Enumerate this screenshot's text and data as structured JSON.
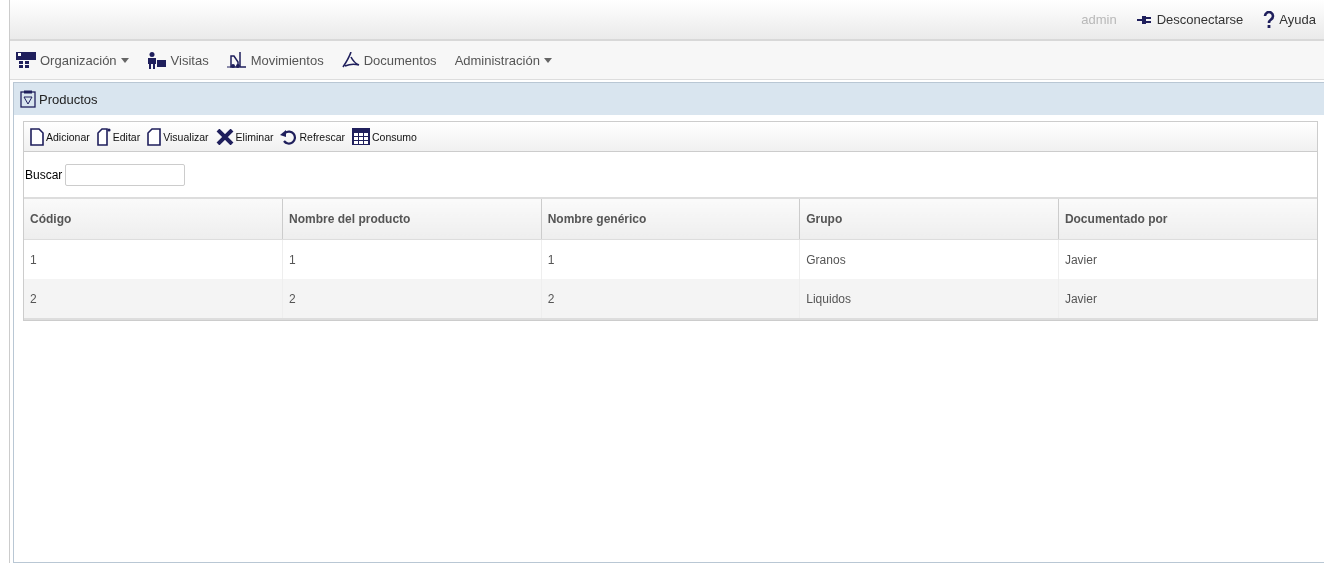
{
  "top_bar": {
    "user": "admin",
    "logout": "Desconectarse",
    "help": "Ayuda"
  },
  "menu": [
    {
      "label": "Organización",
      "dropdown": true
    },
    {
      "label": "Visitas",
      "dropdown": false
    },
    {
      "label": "Movimientos",
      "dropdown": false
    },
    {
      "label": "Documentos",
      "dropdown": false
    },
    {
      "label": "Administración",
      "dropdown": true
    }
  ],
  "panel": {
    "title": "Productos",
    "toolbar": [
      "Adicionar",
      "Editar",
      "Visualizar",
      "Eliminar",
      "Refrescar",
      "Consumo"
    ],
    "search": {
      "label": "Buscar"
    },
    "table": {
      "columns": [
        "Código",
        "Nombre del producto",
        "Nombre genérico",
        "Grupo",
        "Documentado por"
      ],
      "rows": [
        [
          "1",
          "1",
          "1",
          "Granos",
          "Javier"
        ],
        [
          "2",
          "2",
          "2",
          "Liquidos",
          "Javier"
        ]
      ]
    }
  }
}
